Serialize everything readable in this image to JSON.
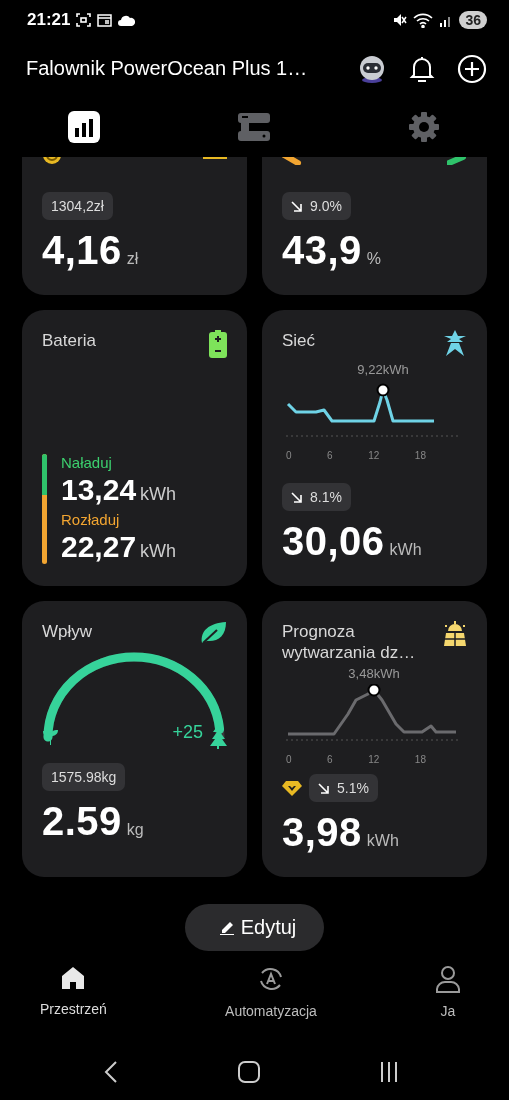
{
  "status_bar": {
    "time": "21:21",
    "battery": "36"
  },
  "header": {
    "title": "Falownik PowerOcean Plus 1…"
  },
  "tabs": [
    {
      "kind": "stats",
      "selected": true
    },
    {
      "kind": "devices",
      "selected": false
    },
    {
      "kind": "settings",
      "selected": false
    }
  ],
  "cards": [
    {
      "kind": "savings",
      "badge": "1304,2zł",
      "value": "4,16",
      "unit": "zł"
    },
    {
      "kind": "ratio",
      "change": "9.0%",
      "value": "43,9",
      "unit": "%"
    },
    {
      "kind": "battery",
      "title": "Bateria",
      "charge_label": "Naładuj",
      "charge_value": "13,24",
      "charge_unit": "kWh",
      "discharge_label": "Rozładuj",
      "discharge_value": "22,27",
      "discharge_unit": "kWh",
      "level": 0.37
    },
    {
      "kind": "grid",
      "title": "Sieć",
      "peak_label": "9,22kWh",
      "x_labels": [
        "0",
        "6",
        "12",
        "18"
      ],
      "change": "8.1%",
      "value": "30,06",
      "unit": "kWh"
    },
    {
      "kind": "impact",
      "title": "Wpływ",
      "trees": "+25",
      "badge": "1575.98kg",
      "value": "2.59",
      "unit": "kg"
    },
    {
      "kind": "forecast",
      "title": "Prognoza wytwarzania dz…",
      "peak_label": "3,48kWh",
      "x_labels": [
        "0",
        "6",
        "12",
        "18"
      ],
      "change": "5.1%",
      "value": "3,98",
      "unit": "kWh"
    }
  ],
  "edit_button": "Edytuj",
  "bottom_nav": [
    {
      "kind": "home",
      "label": "Przestrzeń",
      "selected": true
    },
    {
      "kind": "automation",
      "label": "Automatyzacja",
      "selected": false
    },
    {
      "kind": "profile",
      "label": "Ja",
      "selected": false
    }
  ]
}
